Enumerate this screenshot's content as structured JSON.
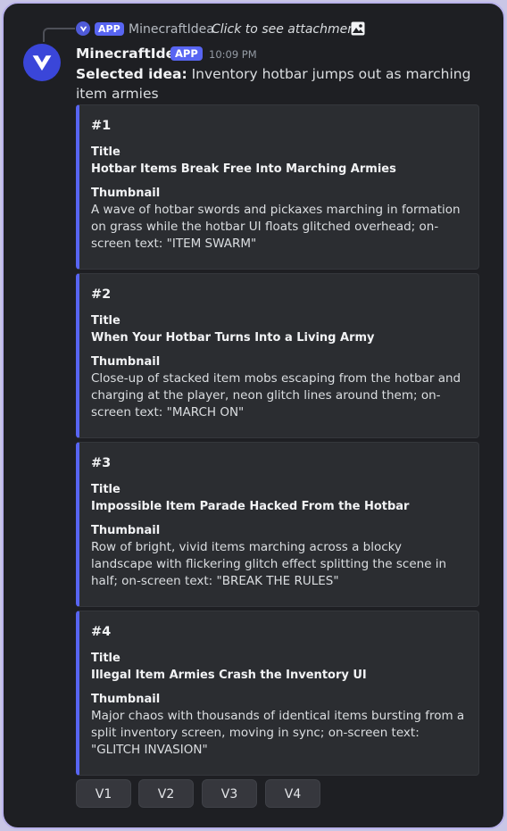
{
  "reply": {
    "app_badge": "APP",
    "author": "MinecraftIdea",
    "text": "Click to see attachment",
    "icon": "image-icon"
  },
  "message": {
    "author": "MinecraftIdea",
    "app_badge": "APP",
    "timestamp": "10:09 PM",
    "selected_label": "Selected idea:",
    "selected_text": " Inventory hotbar jumps out as marching item armies"
  },
  "embeds": [
    {
      "num": "#1",
      "title_label": "Title",
      "title": "Hotbar Items Break Free Into Marching Armies",
      "thumb_label": "Thumbnail",
      "thumbnail": "A wave of hotbar swords and pickaxes marching in formation on grass while the hotbar UI floats glitched overhead; on-screen text: \"ITEM SWARM\""
    },
    {
      "num": "#2",
      "title_label": "Title",
      "title": "When Your Hotbar Turns Into a Living Army",
      "thumb_label": "Thumbnail",
      "thumbnail": "Close-up of stacked item mobs escaping from the hotbar and charging at the player, neon glitch lines around them; on-screen text: \"MARCH ON\""
    },
    {
      "num": "#3",
      "title_label": "Title",
      "title": "Impossible Item Parade Hacked From the Hotbar",
      "thumb_label": "Thumbnail",
      "thumbnail": "Row of bright, vivid items marching across a blocky landscape with flickering glitch effect splitting the scene in half; on-screen text: \"BREAK THE RULES\""
    },
    {
      "num": "#4",
      "title_label": "Title",
      "title": "Illegal Item Armies Crash the Inventory UI",
      "thumb_label": "Thumbnail",
      "thumbnail": "Major chaos with thousands of identical items bursting from a split inventory screen, moving in sync; on-screen text: \"GLITCH INVASION\""
    }
  ],
  "buttons": [
    "V1",
    "V2",
    "V3",
    "V4"
  ],
  "colors": {
    "background": "#1e1f23",
    "embed_bg": "#2b2d31",
    "accent": "#5865f2",
    "frame_border": "#b9b2ea"
  }
}
